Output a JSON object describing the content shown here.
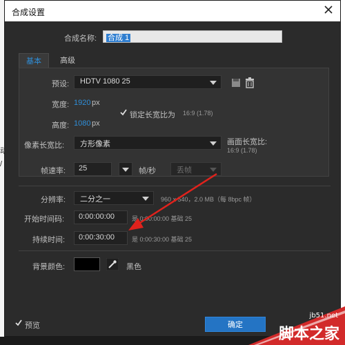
{
  "background": {
    "left_chars": [
      "动",
      "/"
    ],
    "bottom_text": ""
  },
  "dialog": {
    "title": "合成设置",
    "name_label": "合成名称:",
    "name_value": "合成 1",
    "tabs": [
      {
        "label": "基本",
        "active": true
      },
      {
        "label": "高级",
        "active": false
      }
    ],
    "preset_label": "预设:",
    "preset_value": "HDTV 1080 25",
    "width_label": "宽度:",
    "width_value": "1920",
    "width_unit": "px",
    "height_label": "高度:",
    "height_value": "1080",
    "height_unit": "px",
    "lock_aspect_label": "锁定长宽比为",
    "lock_aspect_value": "16:9 (1.78)",
    "pixel_aspect_label": "像素长宽比:",
    "pixel_aspect_value": "方形像素",
    "frame_aspect_label": "画面长宽比:",
    "frame_aspect_value": "16:9 (1.78)",
    "frame_rate_label": "帧速率:",
    "frame_rate_value": "25",
    "frame_rate_unit": "帧/秒",
    "drop_frame_value": "丢帧",
    "resolution_label": "分辨率:",
    "resolution_value": "二分之一",
    "resolution_info": "960 x 540，2.0 MB（每 8bpc 帧）",
    "start_tc_label": "开始时间码:",
    "start_tc_value": "0:00:00:00",
    "start_tc_info": "是 0:00:00:00  基础 25",
    "duration_label": "持续时间:",
    "duration_value": "0:00:30:00",
    "duration_info": "是 0:00:30:00  基础 25",
    "bg_color_label": "背景颜色:",
    "bg_color_name": "黑色",
    "bg_color_hex": "#000000",
    "preview_label": "预览",
    "ok_label": "确定"
  },
  "watermark": {
    "site": "jb51.net",
    "brand": "脚本之家"
  },
  "colors": {
    "accent": "#2f8ed8",
    "dialog_bg": "#2b2b2b",
    "annotation_arrow": "#e0221c"
  }
}
